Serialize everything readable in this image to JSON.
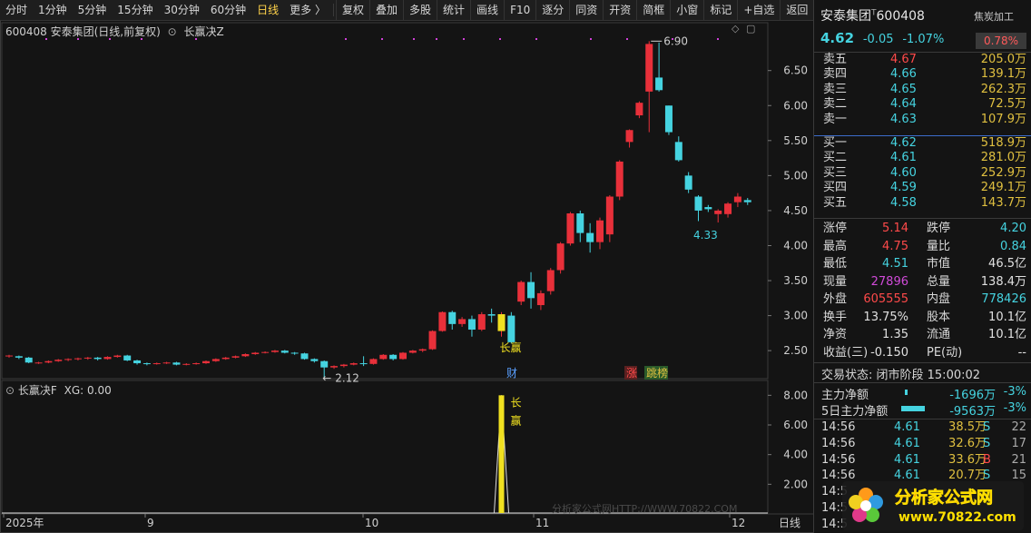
{
  "toolbar": {
    "periods": [
      "分时",
      "1分钟",
      "5分钟",
      "15分钟",
      "30分钟",
      "60分钟",
      "日线",
      "更多 〉"
    ],
    "active_period": "日线",
    "tools": [
      "复权",
      "叠加",
      "多股",
      "统计",
      "画线",
      "F10",
      "逐分",
      "同资",
      "开资",
      "简框",
      "小窗",
      "标记",
      "+自选",
      "返回"
    ]
  },
  "main_chart": {
    "header": "600408 安泰集团(日线,前复权)",
    "indicator": "长赢决Z",
    "high_label": "6.90",
    "low_label_recent": "4.33",
    "low_label_old": "2.12",
    "signal_label": "长赢",
    "event_labels": [
      {
        "text": "财",
        "color": "#5aa0ff"
      },
      {
        "text": "涨",
        "color": "#ff4a4a"
      },
      {
        "text": "跳榜",
        "color": "#e0c040"
      }
    ],
    "y_ticks": [
      "6.50",
      "6.00",
      "5.50",
      "5.00",
      "4.50",
      "4.00",
      "3.50",
      "3.00",
      "2.50"
    ],
    "x_ticks": [
      "2025年",
      "9",
      "10",
      "11",
      "12"
    ],
    "period_label": "日线",
    "watermark": "分析家公式网HTTP://WWW.70822.COM"
  },
  "chart_data": {
    "type": "candlestick",
    "ylim": [
      2.1,
      6.95
    ],
    "candles": [
      [
        2.42,
        2.43,
        2.4,
        2.44
      ],
      [
        2.42,
        2.4,
        2.38,
        2.43
      ],
      [
        2.4,
        2.33,
        2.32,
        2.41
      ],
      [
        2.33,
        2.33,
        2.31,
        2.34
      ],
      [
        2.33,
        2.35,
        2.32,
        2.36
      ],
      [
        2.35,
        2.37,
        2.34,
        2.38
      ],
      [
        2.37,
        2.38,
        2.35,
        2.39
      ],
      [
        2.38,
        2.39,
        2.36,
        2.4
      ],
      [
        2.39,
        2.4,
        2.37,
        2.41
      ],
      [
        2.4,
        2.38,
        2.36,
        2.41
      ],
      [
        2.38,
        2.41,
        2.37,
        2.42
      ],
      [
        2.41,
        2.43,
        2.4,
        2.44
      ],
      [
        2.43,
        2.36,
        2.35,
        2.44
      ],
      [
        2.36,
        2.32,
        2.3,
        2.37
      ],
      [
        2.32,
        2.31,
        2.29,
        2.33
      ],
      [
        2.31,
        2.32,
        2.3,
        2.33
      ],
      [
        2.32,
        2.33,
        2.31,
        2.34
      ],
      [
        2.33,
        2.3,
        2.29,
        2.34
      ],
      [
        2.3,
        2.31,
        2.29,
        2.32
      ],
      [
        2.31,
        2.32,
        2.3,
        2.33
      ],
      [
        2.32,
        2.35,
        2.31,
        2.36
      ],
      [
        2.35,
        2.38,
        2.34,
        2.39
      ],
      [
        2.38,
        2.4,
        2.37,
        2.41
      ],
      [
        2.4,
        2.42,
        2.39,
        2.43
      ],
      [
        2.42,
        2.45,
        2.41,
        2.46
      ],
      [
        2.45,
        2.47,
        2.44,
        2.48
      ],
      [
        2.47,
        2.48,
        2.46,
        2.49
      ],
      [
        2.48,
        2.5,
        2.47,
        2.51
      ],
      [
        2.5,
        2.47,
        2.46,
        2.51
      ],
      [
        2.47,
        2.46,
        2.44,
        2.48
      ],
      [
        2.46,
        2.38,
        2.37,
        2.47
      ],
      [
        2.38,
        2.35,
        2.33,
        2.39
      ],
      [
        2.35,
        2.26,
        2.12,
        2.36
      ],
      [
        2.26,
        2.28,
        2.24,
        2.29
      ],
      [
        2.28,
        2.3,
        2.26,
        2.31
      ],
      [
        2.3,
        2.32,
        2.29,
        2.33
      ],
      [
        2.32,
        2.31,
        2.28,
        2.42
      ],
      [
        2.31,
        2.38,
        2.3,
        2.39
      ],
      [
        2.38,
        2.44,
        2.37,
        2.45
      ],
      [
        2.44,
        2.38,
        2.36,
        2.45
      ],
      [
        2.38,
        2.47,
        2.37,
        2.48
      ],
      [
        2.47,
        2.5,
        2.46,
        2.51
      ],
      [
        2.5,
        2.52,
        2.48,
        2.53
      ],
      [
        2.52,
        2.78,
        2.51,
        2.79
      ],
      [
        2.78,
        3.05,
        2.77,
        3.06
      ],
      [
        3.05,
        2.88,
        2.8,
        3.07
      ],
      [
        2.88,
        2.95,
        2.84,
        2.98
      ],
      [
        2.95,
        2.8,
        2.7,
        3.0
      ],
      [
        2.8,
        3.02,
        2.78,
        3.05
      ],
      [
        3.02,
        3.0,
        2.9,
        3.1
      ],
      [
        2.78,
        3.02,
        2.7,
        3.05
      ],
      [
        3.0,
        2.62,
        2.6,
        3.05
      ],
      [
        3.2,
        3.48,
        3.15,
        3.5
      ],
      [
        3.48,
        3.25,
        3.1,
        3.62
      ],
      [
        3.15,
        3.32,
        3.08,
        3.36
      ],
      [
        3.35,
        3.65,
        3.3,
        3.68
      ],
      [
        3.65,
        4.03,
        3.6,
        4.05
      ],
      [
        4.03,
        4.46,
        4.0,
        4.48
      ],
      [
        4.46,
        4.18,
        4.05,
        4.5
      ],
      [
        4.18,
        4.05,
        3.9,
        4.32
      ],
      [
        4.05,
        4.36,
        3.95,
        4.4
      ],
      [
        4.16,
        4.7,
        4.05,
        4.72
      ],
      [
        4.7,
        5.2,
        4.65,
        5.22
      ],
      [
        5.48,
        5.65,
        5.4,
        5.66
      ],
      [
        5.86,
        6.04,
        5.82,
        6.06
      ],
      [
        6.2,
        6.88,
        5.62,
        6.92
      ],
      [
        6.4,
        6.22,
        6.2,
        6.9
      ],
      [
        6.0,
        5.62,
        5.58,
        6.0
      ],
      [
        5.48,
        5.22,
        5.2,
        5.56
      ],
      [
        5.0,
        4.8,
        4.75,
        5.05
      ],
      [
        4.7,
        4.5,
        4.35,
        4.72
      ],
      [
        4.55,
        4.52,
        4.48,
        4.58
      ],
      [
        4.45,
        4.5,
        4.33,
        4.52
      ],
      [
        4.45,
        4.6,
        4.4,
        4.62
      ],
      [
        4.62,
        4.7,
        4.55,
        4.75
      ],
      [
        4.65,
        4.62,
        4.58,
        4.68
      ]
    ],
    "signal_index": 50,
    "sub_indicator": {
      "title": "长赢决F",
      "series": [
        {
          "name": "XG",
          "last_value": 0.0
        }
      ],
      "ylim": [
        0,
        9
      ],
      "y_ticks": [
        "8.00",
        "6.00",
        "4.00",
        "2.00"
      ],
      "signal_value": 8,
      "signal_text": [
        "长",
        "赢"
      ]
    }
  },
  "sub_chart": {
    "header_name": "长赢决F",
    "header_value": "XG: 0.00"
  },
  "quote": {
    "name": "安泰集团",
    "code": "600408",
    "tag": "焦炭加工",
    "price": "4.62",
    "change": "-0.05",
    "change_pct": "-1.07%",
    "ratio": "0.78%",
    "asks": [
      {
        "label": "卖五",
        "price": "4.67",
        "vol": "205.0万",
        "color": "red"
      },
      {
        "label": "卖四",
        "price": "4.66",
        "vol": "139.1万",
        "color": "cyan"
      },
      {
        "label": "卖三",
        "price": "4.65",
        "vol": "262.3万",
        "color": "cyan"
      },
      {
        "label": "卖二",
        "price": "4.64",
        "vol": "72.5万",
        "color": "cyan"
      },
      {
        "label": "卖一",
        "price": "4.63",
        "vol": "107.9万",
        "color": "cyan"
      }
    ],
    "bids": [
      {
        "label": "买一",
        "price": "4.62",
        "vol": "518.9万",
        "color": "cyan"
      },
      {
        "label": "买二",
        "price": "4.61",
        "vol": "281.0万",
        "color": "cyan"
      },
      {
        "label": "买三",
        "price": "4.60",
        "vol": "252.9万",
        "color": "cyan"
      },
      {
        "label": "买四",
        "price": "4.59",
        "vol": "249.1万",
        "color": "cyan"
      },
      {
        "label": "买五",
        "price": "4.58",
        "vol": "143.7万",
        "color": "cyan"
      }
    ],
    "stats": [
      {
        "k1": "涨停",
        "v1": "5.14",
        "c1": "red",
        "k2": "跌停",
        "v2": "4.20",
        "c2": "cyan"
      },
      {
        "k1": "最高",
        "v1": "4.75",
        "c1": "red",
        "k2": "量比",
        "v2": "0.84",
        "c2": "cyan"
      },
      {
        "k1": "最低",
        "v1": "4.51",
        "c1": "cyan",
        "k2": "市值",
        "v2": "46.5亿",
        "c2": "white"
      },
      {
        "k1": "现量",
        "v1": "27896",
        "c1": "magenta",
        "k2": "总量",
        "v2": "138.4万",
        "c2": "white"
      },
      {
        "k1": "外盘",
        "v1": "605555",
        "c1": "red",
        "k2": "内盘",
        "v2": "778426",
        "c2": "cyan"
      },
      {
        "k1": "换手",
        "v1": "13.75%",
        "c1": "white",
        "k2": "股本",
        "v2": "10.1亿",
        "c2": "white"
      },
      {
        "k1": "净资",
        "v1": "1.35",
        "c1": "white",
        "k2": "流通",
        "v2": "10.1亿",
        "c2": "white"
      },
      {
        "k1": "收益(三)",
        "v1": "-0.150",
        "c1": "white",
        "k2": "PE(动)",
        "v2": "--",
        "c2": "white"
      }
    ],
    "status": "交易状态: 闭市阶段 15:00:02",
    "flows": [
      {
        "label": "主力净额",
        "value": "-1696万",
        "pct": "-3%"
      },
      {
        "label": "5日主力净额",
        "value": "-9563万",
        "pct": "-3%"
      }
    ],
    "ticks": [
      {
        "time": "14:56",
        "price": "4.61",
        "vol": "38.5万",
        "side": "S",
        "cnt": "22"
      },
      {
        "time": "14:56",
        "price": "4.61",
        "vol": "32.6万",
        "side": "S",
        "cnt": "17"
      },
      {
        "time": "14:56",
        "price": "4.61",
        "vol": "33.6万",
        "side": "B",
        "cnt": "21"
      },
      {
        "time": "14:56",
        "price": "4.61",
        "vol": "20.7万",
        "side": "S",
        "cnt": "15"
      },
      {
        "time": "14:5",
        "price": "",
        "vol": "",
        "side": "",
        "cnt": ""
      },
      {
        "time": "14:5",
        "price": "",
        "vol": "",
        "side": "",
        "cnt": ""
      },
      {
        "time": "14:5",
        "price": "",
        "vol": "",
        "side": "",
        "cnt": ""
      }
    ]
  },
  "badge": {
    "title": "分析家公式网",
    "url": "www.70822.com"
  }
}
